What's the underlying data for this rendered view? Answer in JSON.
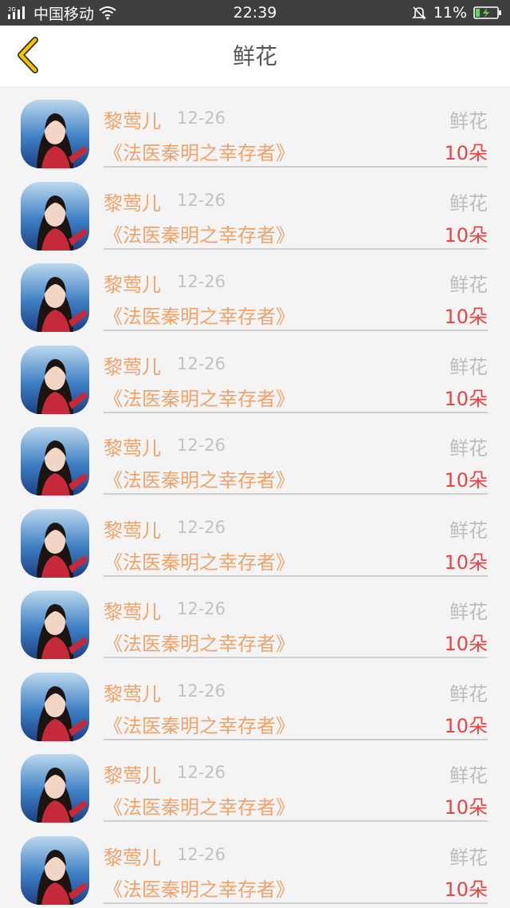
{
  "status_bar": {
    "network_type": "2G",
    "carrier": "中国移动",
    "time": "22:39",
    "battery": "11%"
  },
  "nav": {
    "title": "鲜花",
    "back_icon": "chevron-left-icon",
    "accent_color": "#f5c400"
  },
  "list": {
    "items": [
      {
        "name": "黎莺儿",
        "date": "12-26",
        "type": "鲜花",
        "book": "《法医秦明之幸存者》",
        "amount": "10朵"
      },
      {
        "name": "黎莺儿",
        "date": "12-26",
        "type": "鲜花",
        "book": "《法医秦明之幸存者》",
        "amount": "10朵"
      },
      {
        "name": "黎莺儿",
        "date": "12-26",
        "type": "鲜花",
        "book": "《法医秦明之幸存者》",
        "amount": "10朵"
      },
      {
        "name": "黎莺儿",
        "date": "12-26",
        "type": "鲜花",
        "book": "《法医秦明之幸存者》",
        "amount": "10朵"
      },
      {
        "name": "黎莺儿",
        "date": "12-26",
        "type": "鲜花",
        "book": "《法医秦明之幸存者》",
        "amount": "10朵"
      },
      {
        "name": "黎莺儿",
        "date": "12-26",
        "type": "鲜花",
        "book": "《法医秦明之幸存者》",
        "amount": "10朵"
      },
      {
        "name": "黎莺儿",
        "date": "12-26",
        "type": "鲜花",
        "book": "《法医秦明之幸存者》",
        "amount": "10朵"
      },
      {
        "name": "黎莺儿",
        "date": "12-26",
        "type": "鲜花",
        "book": "《法医秦明之幸存者》",
        "amount": "10朵"
      },
      {
        "name": "黎莺儿",
        "date": "12-26",
        "type": "鲜花",
        "book": "《法医秦明之幸存者》",
        "amount": "10朵"
      },
      {
        "name": "黎莺儿",
        "date": "12-26",
        "type": "鲜花",
        "book": "《法医秦明之幸存者》",
        "amount": "10朵"
      }
    ]
  },
  "colors": {
    "name_text": "#f0a36a",
    "amount_text": "#e84545",
    "secondary_text": "#bdbdbd"
  }
}
